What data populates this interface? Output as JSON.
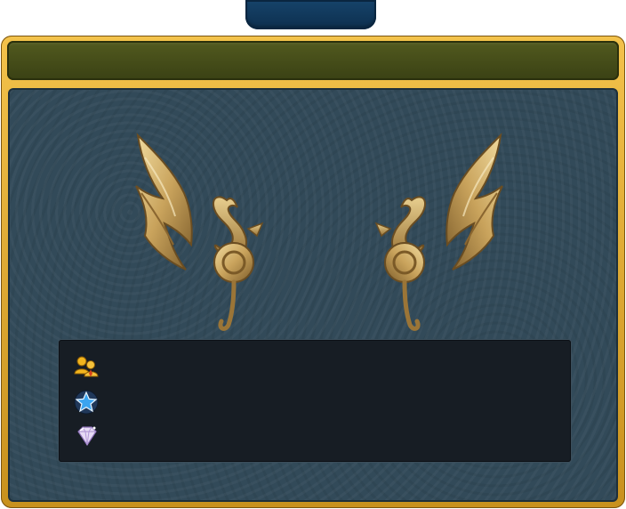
{
  "window": {
    "tab_label": "",
    "header_title": ""
  },
  "item": {
    "name": "",
    "image_icon": "golden-dragon-wings-icon"
  },
  "stats": {
    "rows": [
      {
        "icon": "party-members-icon",
        "value": ""
      },
      {
        "icon": "blue-star-icon",
        "value": ""
      },
      {
        "icon": "diamond-gem-icon",
        "value": ""
      }
    ]
  },
  "colors": {
    "frame_gold": "#e2ad35",
    "header_olive": "#4a521b",
    "panel_slate": "#324a59",
    "info_box": "#171d24",
    "tab_navy": "#123b60"
  }
}
